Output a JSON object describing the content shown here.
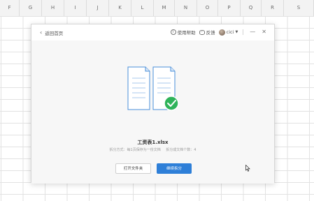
{
  "columns": [
    "F",
    "G",
    "H",
    "I",
    "J",
    "K",
    "L",
    "M",
    "N",
    "O",
    "P",
    "Q",
    "R",
    "S"
  ],
  "dialog": {
    "back_label": "返回首页",
    "help_label": "使用帮助",
    "feedback_label": "反馈",
    "user_name": "cici",
    "minimize": "—",
    "close": "✕"
  },
  "result": {
    "filename": "工资表1.xlsx",
    "method_text": "拆分方式：每1页保存为一份文档",
    "count_text": "拆分成文档个数：4"
  },
  "buttons": {
    "open_folder": "打开文件夹",
    "continue_split": "继续拆分"
  },
  "colors": {
    "accent": "#2e7fd8",
    "success": "#2fb35a",
    "doc_stroke": "#4a8fd9"
  }
}
